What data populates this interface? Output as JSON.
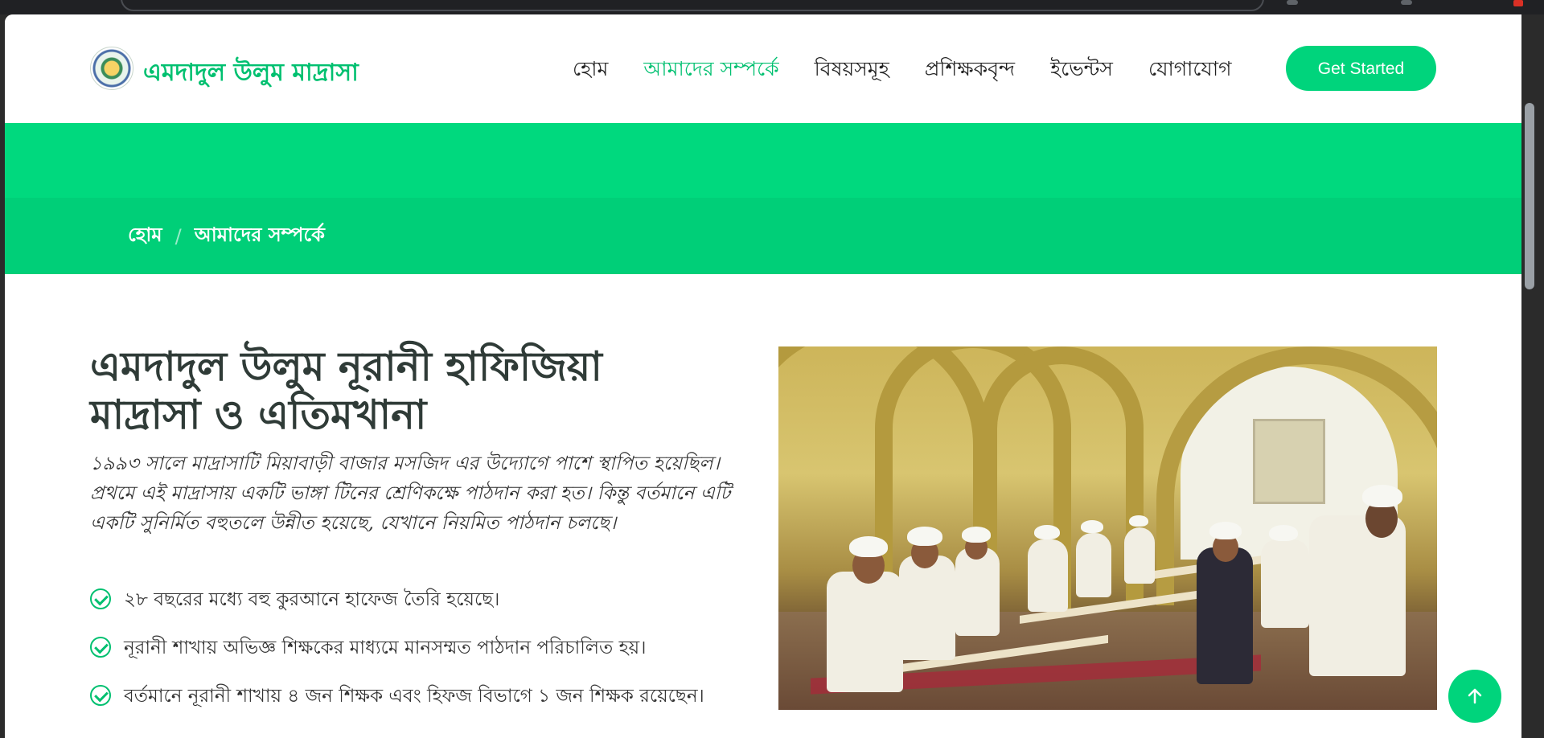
{
  "site": {
    "name": "এমদাদুল উলুম মাদ্রাসা",
    "logo_icon": "madrasa-seal-icon"
  },
  "nav": {
    "items": [
      {
        "label": "হোম",
        "active": false
      },
      {
        "label": "আমাদের সম্পর্কে",
        "active": true
      },
      {
        "label": "বিষয়সমূহ",
        "active": false
      },
      {
        "label": "প্রশিক্ষকবৃন্দ",
        "active": false
      },
      {
        "label": "ইভেন্টস",
        "active": false
      },
      {
        "label": "যোগাযোগ",
        "active": false
      }
    ],
    "cta_label": "Get Started"
  },
  "breadcrumb": {
    "home": "হোম",
    "separator": "/",
    "current": "আমাদের সম্পর্কে"
  },
  "about": {
    "title_line1": "এমদাদুল উলুম নূরানী হাফিজিয়া",
    "title_line2": "মাদ্রাসা ও এতিমখানা",
    "intro": "১৯৯৩ সালে মাদ্রাসাটি মিয়াবাড়ী বাজার মসজিদ এর উদ্যোগে পাশে স্থাপিত হয়েছিল। প্রথমে এই মাদ্রাসায় একটি ভাঙ্গা টিনের শ্রেণিকক্ষে পাঠদান করা হত। কিন্তু বর্তমানে এটি একটি সুনির্মিত বহুতলে উন্নীত হয়েছে, যেখানে নিয়মিত পাঠদান চলছে।",
    "features": [
      "২৮ বছরের মধ্যে বহু কুরআনে হাফেজ তৈরি হয়েছে।",
      "নূরানী শাখায় অভিজ্ঞ শিক্ষকের মাধ্যমে মানসম্মত পাঠদান পরিচালিত হয়।",
      "বর্তমানে নূরানী শাখায় ৪ জন শিক্ষক এবং হিফজ বিভাগে ১ জন শিক্ষক রয়েছেন।"
    ]
  },
  "icons": {
    "check": "check-circle-icon",
    "back_to_top": "arrow-up-icon"
  },
  "colors": {
    "accent": "#00d47c",
    "accent_dark": "#00c070",
    "band_top": "#00d97e",
    "band_bottom": "#00cf78",
    "heading": "#2f3b37"
  }
}
